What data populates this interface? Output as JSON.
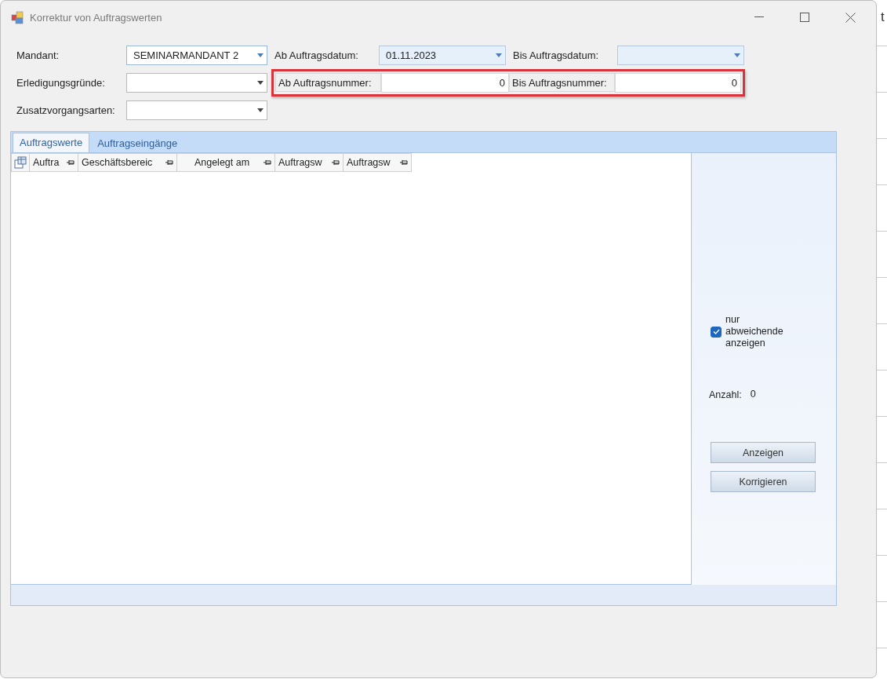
{
  "window": {
    "title": "Korrektur von Auftragswerten"
  },
  "filter_rows": [
    {
      "items": [
        {
          "kind": "combo",
          "label": "Mandant:",
          "value": "SEMINARMANDANT 2"
        },
        {
          "kind": "date",
          "label": "Ab Auftragsdatum:",
          "value": "01.11.2023"
        },
        {
          "kind": "date",
          "label": "Bis Auftragsdatum:"
        }
      ]
    },
    {
      "items": [
        {
          "kind": "combo",
          "label": "Erledigungsgründe:"
        },
        {
          "kind": "group",
          "highlighted": true,
          "items": [
            {
              "kind": "number",
              "label": "Ab Auftragsnummer:",
              "value": "0"
            },
            {
              "kind": "number",
              "label": "Bis Auftragsnummer:",
              "value": "0"
            }
          ]
        }
      ]
    },
    {
      "items": [
        {
          "kind": "combo",
          "label": "Zusatzvorgangsarten:"
        }
      ]
    }
  ],
  "tabs": [
    {
      "label": "Auftragswerte",
      "selected": true
    },
    {
      "label": "Auftragseingänge",
      "selected": false
    }
  ],
  "table": {
    "columns": [
      "Auftra",
      "Geschäftsbereic",
      "Angelegt am",
      "Auftragsw",
      "Auftragsw"
    ]
  },
  "side_panel": {
    "checkbox": {
      "label": "nur abweichende anzeigen",
      "checked": true
    },
    "count": {
      "label": "Anzahl:",
      "value": "0"
    },
    "buttons": [
      "Anzeigen",
      "Korrigieren"
    ]
  },
  "background_window": {
    "text": "t"
  }
}
